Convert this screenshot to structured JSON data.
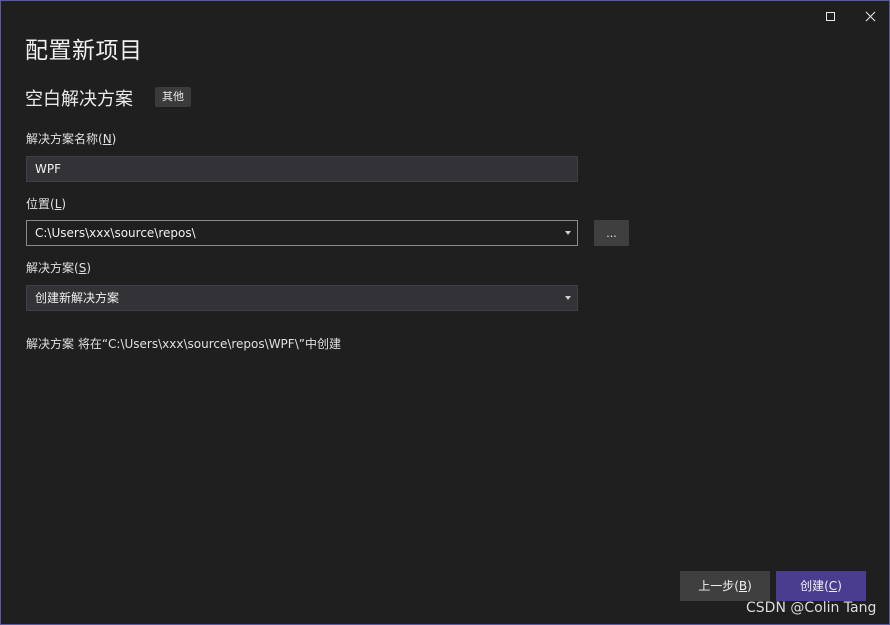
{
  "window": {
    "title": "配置新项目",
    "subtitle": "空白解决方案",
    "tag": "其他"
  },
  "solution_name": {
    "label_prefix": "解决方案名称(",
    "label_key": "N",
    "label_suffix": ")",
    "value": "WPF"
  },
  "location": {
    "label_prefix": "位置(",
    "label_key": "L",
    "label_suffix": ")",
    "value": "C:\\Users\\xxx\\source\\repos\\",
    "browse_label": "..."
  },
  "solution": {
    "label_prefix": "解决方案(",
    "label_key": "S",
    "label_suffix": ")",
    "value": "创建新解决方案"
  },
  "info_text": "解决方案 将在“C:\\Users\\xxx\\source\\repos\\WPF\\”中创建",
  "buttons": {
    "back_prefix": "上一步(",
    "back_key": "B",
    "back_suffix": ")",
    "create_prefix": "创建(",
    "create_key": "C",
    "create_suffix": ")"
  },
  "watermark": "CSDN @Colin Tang",
  "icons": {
    "maximize": "maximize-icon",
    "close": "close-icon",
    "dropdown": "chevron-down-icon"
  }
}
